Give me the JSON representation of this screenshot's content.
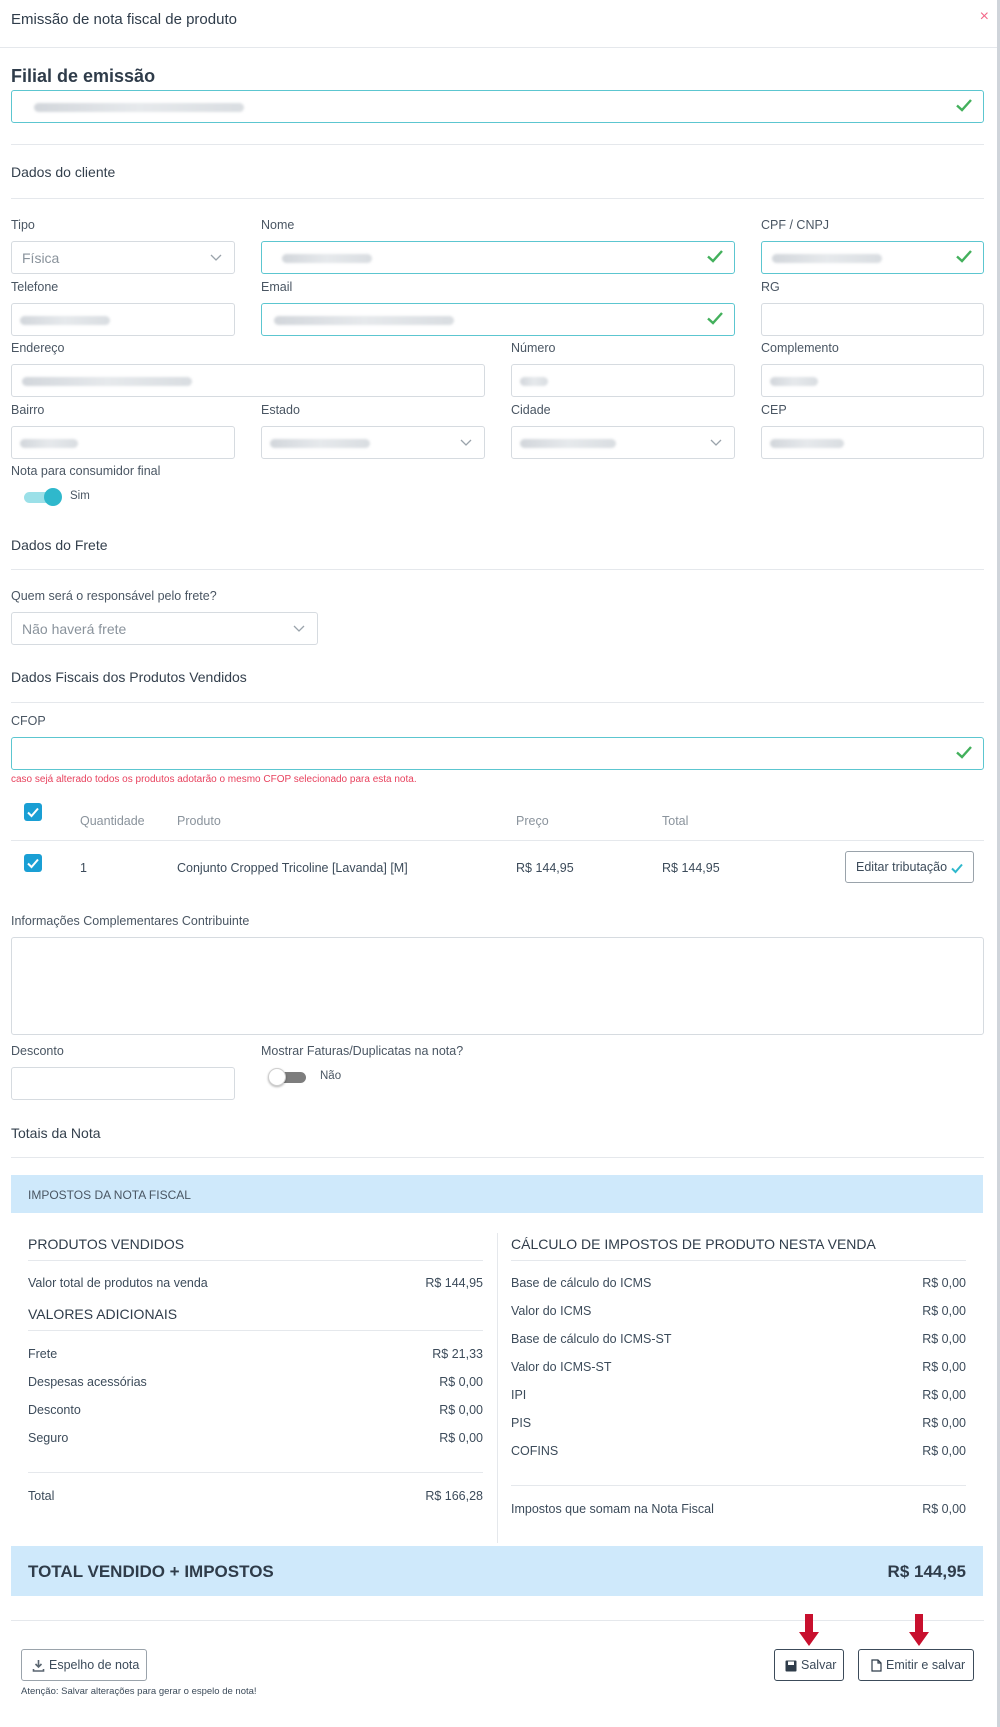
{
  "modal": {
    "title": "Emissão de nota fiscal de produto",
    "close": "×"
  },
  "filial": {
    "title": "Filial de emissão"
  },
  "cliente": {
    "title": "Dados do cliente",
    "tipo_label": "Tipo",
    "tipo_value": "Física",
    "nome_label": "Nome",
    "cpf_label": "CPF / CNPJ",
    "telefone_label": "Telefone",
    "email_label": "Email",
    "rg_label": "RG",
    "endereco_label": "Endereço",
    "numero_label": "Número",
    "complemento_label": "Complemento",
    "bairro_label": "Bairro",
    "estado_label": "Estado",
    "cidade_label": "Cidade",
    "cep_label": "CEP",
    "consumidor_label": "Nota para consumidor final",
    "consumidor_value": "Sim"
  },
  "frete": {
    "title": "Dados do Frete",
    "question": "Quem será o responsável pelo frete?",
    "value": "Não haverá frete"
  },
  "fiscais": {
    "title": "Dados Fiscais dos Produtos Vendidos",
    "cfop_label": "CFOP",
    "warning": "caso sejá alterado todos os produtos adotarão o mesmo CFOP selecionado para esta nota.",
    "headers": [
      "Quantidade",
      "Produto",
      "Preço",
      "Total"
    ],
    "rows": [
      {
        "qty": "1",
        "product": "Conjunto Cropped Tricoline [Lavanda] [M]",
        "price": "R$ 144,95",
        "total": "R$ 144,95",
        "action": "Editar tributação"
      }
    ]
  },
  "info": {
    "label": "Informações Complementares Contribuinte"
  },
  "desconto": {
    "label": "Desconto"
  },
  "faturas": {
    "label": "Mostrar Faturas/Duplicatas na nota?",
    "value": "Não"
  },
  "totais": {
    "title": "Totais da Nota",
    "panel_title": "IMPOSTOS DA NOTA FISCAL",
    "produtos_title": "PRODUTOS VENDIDOS",
    "valor_total_label": "Valor total de produtos na venda",
    "valor_total_value": "R$ 144,95",
    "adicionais_title": "VALORES ADICIONAIS",
    "adicionais": [
      {
        "label": "Frete",
        "value": "R$ 21,33"
      },
      {
        "label": "Despesas acessórias",
        "value": "R$ 0,00"
      },
      {
        "label": "Desconto",
        "value": "R$ 0,00"
      },
      {
        "label": "Seguro",
        "value": "R$ 0,00"
      }
    ],
    "total_label": "Total",
    "total_value": "R$ 166,28",
    "impostos_title": "CÁLCULO DE IMPOSTOS DE PRODUTO NESTA VENDA",
    "impostos": [
      {
        "label": "Base de cálculo do ICMS",
        "value": "R$ 0,00"
      },
      {
        "label": "Valor do ICMS",
        "value": "R$ 0,00"
      },
      {
        "label": "Base de cálculo do ICMS-ST",
        "value": "R$ 0,00"
      },
      {
        "label": "Valor do ICMS-ST",
        "value": "R$ 0,00"
      },
      {
        "label": "IPI",
        "value": "R$ 0,00"
      },
      {
        "label": "PIS",
        "value": "R$ 0,00"
      },
      {
        "label": "COFINS",
        "value": "R$ 0,00"
      }
    ],
    "impostos_soma_label": "Impostos que somam na Nota Fiscal",
    "impostos_soma_value": "R$ 0,00",
    "grand_label": "TOTAL VENDIDO + IMPOSTOS",
    "grand_value": "R$ 144,95"
  },
  "footer": {
    "espelho_label": "Espelho de nota",
    "attention": "Atenção: Salvar alterações para gerar o espelo de nota!",
    "salvar_label": "Salvar",
    "emitir_label": "Emitir e salvar"
  },
  "colors": {
    "accent": "#5cc6d0",
    "ok": "#43b05c",
    "checkbox": "#1a9fd4",
    "panel": "#cfe9fb",
    "arrow": "#c8102e",
    "warning": "#e8425e"
  }
}
